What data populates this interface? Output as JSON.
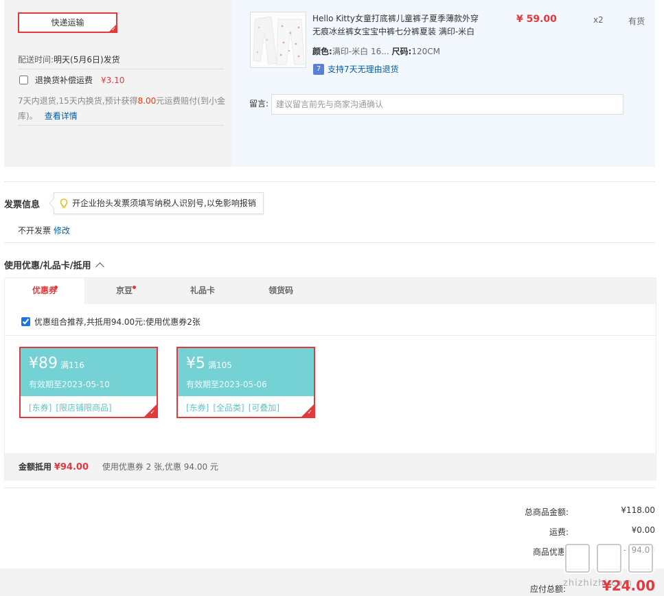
{
  "shipping": {
    "express_label": "快递运输",
    "delivery_time_label": "配送时间:",
    "delivery_time_value": "明天(5月6日)发货",
    "return_option_label": "退换货补偿运费",
    "return_option_price": "¥3.10",
    "return_note_pre": "7天内退货,15天内换货,预计获得",
    "return_note_amount": "8.00",
    "return_note_post": "元运费赔付(到小金库)。",
    "return_note_link": "查看详情"
  },
  "product": {
    "title": "Hello Kitty女童打底裤儿童裤子夏季薄款外穿无痕冰丝裤女宝宝中裤七分裤夏装 满印-米白",
    "price": "¥ 59.00",
    "qty": "x2",
    "stock": "有货",
    "color_label": "颜色:",
    "color_value": "满印-米白 16...",
    "size_label": "尺码:",
    "size_value": "120CM",
    "return_badge": "7",
    "return_text": "支持7天无理由退货",
    "message_label": "留言:",
    "message_placeholder": "建议留言前先与商家沟通确认"
  },
  "invoice": {
    "title": "发票信息",
    "tip": "开企业抬头发票须填写纳税人识别号,以免影响报销",
    "value": "不开发票",
    "edit_link": "修改"
  },
  "coupons": {
    "title": "使用优惠/礼品卡/抵用",
    "tabs": [
      {
        "label": "优惠券"
      },
      {
        "label": "京豆"
      },
      {
        "label": "礼品卡"
      },
      {
        "label": "领货码"
      }
    ],
    "combo_text": "优惠组合推荐,共抵用94.00元:使用优惠券2张",
    "items": [
      {
        "amount": "¥89",
        "condition": "满116",
        "expiry": "有效期至2023-05-10",
        "tags": [
          "[东券]",
          "[限店铺限商品]"
        ]
      },
      {
        "amount": "¥5",
        "condition": "满105",
        "expiry": "有效期至2023-05-06",
        "tags": [
          "[东券]",
          "[全品类]",
          "[可叠加]"
        ]
      }
    ],
    "summary_label": "金额抵用",
    "summary_amount": "¥94.00",
    "summary_text": "使用优惠券 2 张,优惠 94.00 元"
  },
  "totals": {
    "goods_label": "总商品金额:",
    "goods_value": "¥118.00",
    "shipping_label": "运费:",
    "shipping_value": "¥0.00",
    "discount_label": "商品优惠:",
    "discount_value": "-¥94.00",
    "pay_label": "应付总额:",
    "pay_value": "¥24.00"
  },
  "watermark": {
    "site": "zhizhizhi.com"
  },
  "colors": {
    "accent_red": "#e4393c",
    "link_blue": "#005ea7",
    "coupon_teal": "#74d2d5"
  }
}
